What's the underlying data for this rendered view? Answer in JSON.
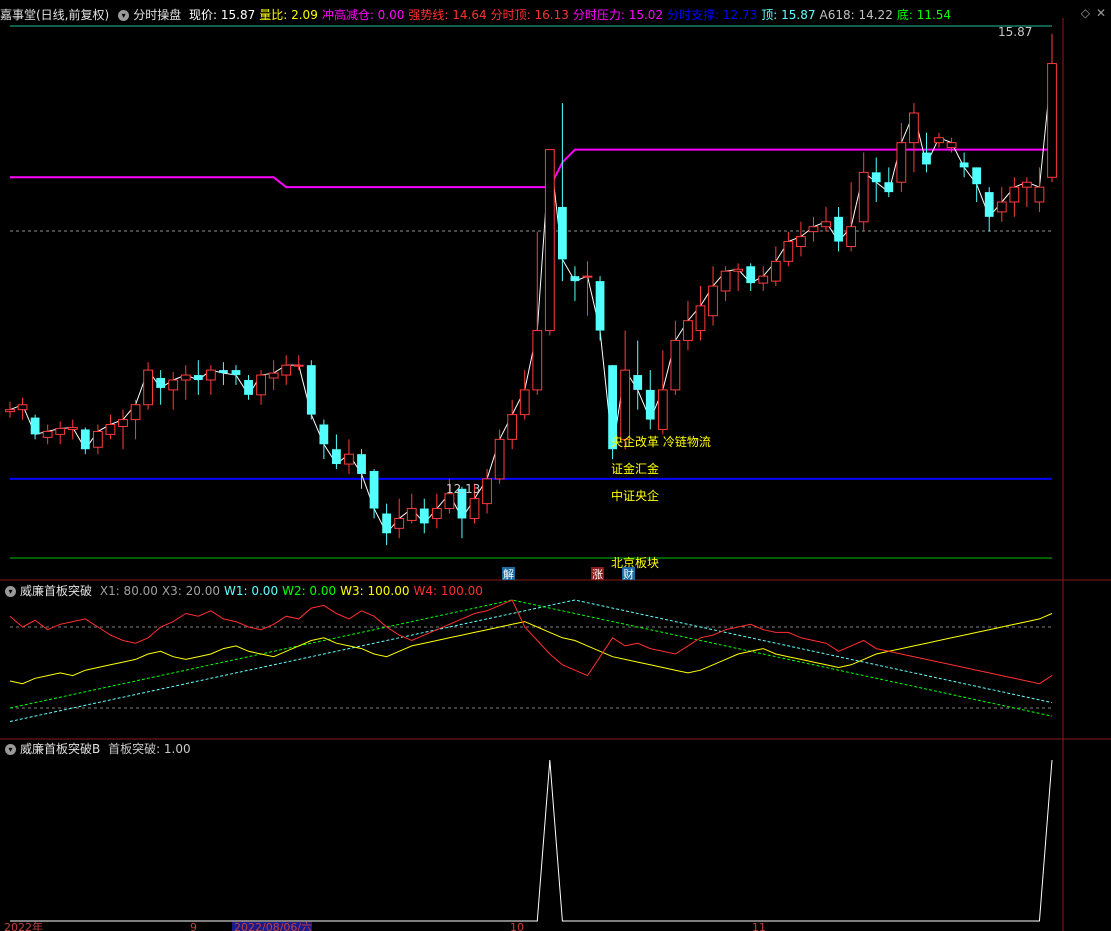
{
  "main_indicator": {
    "name": "嘉事堂(日线,前复权)",
    "formula": "分时操盘",
    "items": [
      {
        "label": "现价: ",
        "value": "15.87",
        "color": "#ffffff"
      },
      {
        "label": "量比: ",
        "value": "2.09",
        "color": "#ffff00"
      },
      {
        "label": "冲高减仓: ",
        "value": "0.00",
        "color": "#ff00ff"
      },
      {
        "label": "强势线: ",
        "value": "14.64",
        "color": "#ff3030"
      },
      {
        "label": "分时顶: ",
        "value": "16.13",
        "color": "#ff3030"
      },
      {
        "label": "分时压力: ",
        "value": "15.02",
        "color": "#ff00ff"
      },
      {
        "label": "分时支撑: ",
        "value": "12.73",
        "color": "#0000ff"
      },
      {
        "label": "顶: ",
        "value": "15.87",
        "color": "#60ffff"
      },
      {
        "label": "A618: ",
        "value": "14.22",
        "color": "#c0c0c0"
      },
      {
        "label": "底: ",
        "value": "11.54",
        "color": "#00ff00"
      }
    ]
  },
  "annotations": {
    "high_label": "15.87",
    "low_label": "12.13",
    "concepts": [
      "央企改革 冷链物流",
      "证金汇金",
      "中证央企",
      "北京板块"
    ],
    "markers": [
      "解",
      "涨",
      "财"
    ]
  },
  "pane1": {
    "name": "威廉首板突破",
    "items": [
      {
        "label": "X1: ",
        "value": "80.00",
        "color": "#a0a0a0"
      },
      {
        "label": "X3: ",
        "value": "20.00",
        "color": "#a0a0a0"
      },
      {
        "label": "W1: ",
        "value": "0.00",
        "color": "#60ffff"
      },
      {
        "label": "W2: ",
        "value": "0.00",
        "color": "#00ff00"
      },
      {
        "label": "W3: ",
        "value": "100.00",
        "color": "#ffff00"
      },
      {
        "label": "W4: ",
        "value": "100.00",
        "color": "#ff3030"
      }
    ]
  },
  "pane2": {
    "name": "威廉首板突破B",
    "items": [
      {
        "label": "首板突破: ",
        "value": "1.00",
        "color": "#c8c8c8"
      }
    ]
  },
  "date_axis": [
    "2022年",
    "9",
    "2022/08/06/六",
    "10",
    "11"
  ],
  "chart_data": {
    "type": "candlestick",
    "candles": [
      [
        13.48,
        13.5,
        13.58,
        13.42
      ],
      [
        13.5,
        13.55,
        13.62,
        13.4
      ],
      [
        13.42,
        13.25,
        13.45,
        13.2
      ],
      [
        13.22,
        13.28,
        13.35,
        13.15
      ],
      [
        13.25,
        13.31,
        13.38,
        13.15
      ],
      [
        13.3,
        13.32,
        13.4,
        13.2
      ],
      [
        13.3,
        13.1,
        13.32,
        13.05
      ],
      [
        13.12,
        13.28,
        13.35,
        13.05
      ],
      [
        13.25,
        13.35,
        13.45,
        13.2
      ],
      [
        13.33,
        13.4,
        13.5,
        13.1
      ],
      [
        13.4,
        13.55,
        13.6,
        13.2
      ],
      [
        13.55,
        13.9,
        13.98,
        13.5
      ],
      [
        13.82,
        13.72,
        13.9,
        13.55
      ],
      [
        13.7,
        13.8,
        13.88,
        13.5
      ],
      [
        13.8,
        13.85,
        13.95,
        13.6
      ],
      [
        13.85,
        13.8,
        14.0,
        13.65
      ],
      [
        13.8,
        13.9,
        13.95,
        13.65
      ],
      [
        13.9,
        13.87,
        13.98,
        13.75
      ],
      [
        13.9,
        13.85,
        13.95,
        13.75
      ],
      [
        13.8,
        13.65,
        13.85,
        13.6
      ],
      [
        13.65,
        13.85,
        13.9,
        13.55
      ],
      [
        13.82,
        13.87,
        14.0,
        13.7
      ],
      [
        13.85,
        13.95,
        14.05,
        13.75
      ],
      [
        13.95,
        13.95,
        14.05,
        13.9
      ],
      [
        13.95,
        13.45,
        14.0,
        13.4
      ],
      [
        13.35,
        13.15,
        13.4,
        13.0
      ],
      [
        13.1,
        12.95,
        13.25,
        12.9
      ],
      [
        12.95,
        13.05,
        13.2,
        12.85
      ],
      [
        13.05,
        12.85,
        13.1,
        12.7
      ],
      [
        12.88,
        12.5,
        12.9,
        12.4
      ],
      [
        12.45,
        12.25,
        12.55,
        12.13
      ],
      [
        12.3,
        12.4,
        12.6,
        12.2
      ],
      [
        12.38,
        12.5,
        12.65,
        12.35
      ],
      [
        12.5,
        12.35,
        12.6,
        12.25
      ],
      [
        12.4,
        12.5,
        12.65,
        12.3
      ],
      [
        12.5,
        12.65,
        12.8,
        12.45
      ],
      [
        12.7,
        12.4,
        12.72,
        12.2
      ],
      [
        12.4,
        12.6,
        12.75,
        12.35
      ],
      [
        12.55,
        12.8,
        12.9,
        12.45
      ],
      [
        12.8,
        13.2,
        13.3,
        12.75
      ],
      [
        13.2,
        13.45,
        13.6,
        13.1
      ],
      [
        13.45,
        13.7,
        13.9,
        13.4
      ],
      [
        13.7,
        14.3,
        15.3,
        13.65
      ],
      [
        14.3,
        16.13,
        16.13,
        14.25
      ],
      [
        15.55,
        15.02,
        16.6,
        14.8
      ],
      [
        14.85,
        14.8,
        14.95,
        14.6
      ],
      [
        14.85,
        14.85,
        15.0,
        14.45
      ],
      [
        14.8,
        14.3,
        14.85,
        14.2
      ],
      [
        13.95,
        13.1,
        13.95,
        13.0
      ],
      [
        13.2,
        13.9,
        14.3,
        13.1
      ],
      [
        13.85,
        13.7,
        14.2,
        13.5
      ],
      [
        13.7,
        13.4,
        13.9,
        13.3
      ],
      [
        13.3,
        13.7,
        14.1,
        13.25
      ],
      [
        13.7,
        14.2,
        14.4,
        13.65
      ],
      [
        14.2,
        14.4,
        14.6,
        14.1
      ],
      [
        14.3,
        14.55,
        14.75,
        14.2
      ],
      [
        14.45,
        14.75,
        14.95,
        14.35
      ],
      [
        14.7,
        14.9,
        14.95,
        14.6
      ],
      [
        14.9,
        14.92,
        14.98,
        14.7
      ],
      [
        14.95,
        14.78,
        14.98,
        14.7
      ],
      [
        14.78,
        14.85,
        14.95,
        14.7
      ],
      [
        14.8,
        15.0,
        15.15,
        14.75
      ],
      [
        15.0,
        15.2,
        15.3,
        14.95
      ],
      [
        15.15,
        15.25,
        15.4,
        15.05
      ],
      [
        15.3,
        15.35,
        15.45,
        15.2
      ],
      [
        15.35,
        15.4,
        15.55,
        15.3
      ],
      [
        15.45,
        15.2,
        15.55,
        15.1
      ],
      [
        15.15,
        15.35,
        15.8,
        15.1
      ],
      [
        15.4,
        15.9,
        16.1,
        15.3
      ],
      [
        15.9,
        15.8,
        16.05,
        15.6
      ],
      [
        15.8,
        15.7,
        15.95,
        15.65
      ],
      [
        15.8,
        16.2,
        16.4,
        15.7
      ],
      [
        16.2,
        16.5,
        16.6,
        15.9
      ],
      [
        16.1,
        15.98,
        16.3,
        15.9
      ],
      [
        16.2,
        16.25,
        16.3,
        16.15
      ],
      [
        16.15,
        16.2,
        16.25,
        16.1
      ],
      [
        16.0,
        15.95,
        16.1,
        15.85
      ],
      [
        15.95,
        15.78,
        15.95,
        15.6
      ],
      [
        15.7,
        15.45,
        15.75,
        15.3
      ],
      [
        15.5,
        15.6,
        15.75,
        15.4
      ],
      [
        15.6,
        15.75,
        15.85,
        15.45
      ],
      [
        15.75,
        15.8,
        15.85,
        15.55
      ],
      [
        15.6,
        15.75,
        15.95,
        15.5
      ],
      [
        15.85,
        17.0,
        17.3,
        15.8
      ]
    ],
    "pressure_line": [
      15.85,
      15.85,
      15.85,
      15.85,
      15.85,
      15.85,
      15.85,
      15.85,
      15.85,
      15.85,
      15.85,
      15.85,
      15.85,
      15.85,
      15.85,
      15.85,
      15.85,
      15.85,
      15.85,
      15.85,
      15.85,
      15.85,
      15.75,
      15.75,
      15.75,
      15.75,
      15.75,
      15.75,
      15.75,
      15.75,
      15.75,
      15.75,
      15.75,
      15.75,
      15.75,
      15.75,
      15.75,
      15.75,
      15.75,
      15.75,
      15.75,
      15.75,
      15.75,
      15.75,
      16.0,
      16.13,
      16.13,
      16.13,
      16.13,
      16.13,
      16.13,
      16.13,
      16.13,
      16.13,
      16.13,
      16.13,
      16.13,
      16.13,
      16.13,
      16.13,
      16.13,
      16.13,
      16.13,
      16.13,
      16.13,
      16.13,
      16.13,
      16.13,
      16.13,
      16.13,
      16.13,
      16.13,
      16.13,
      16.13,
      16.13,
      16.13,
      16.13,
      16.13,
      16.13,
      16.13,
      16.13,
      16.13,
      16.13,
      16.13
    ],
    "support_line": [
      12.8,
      12.8,
      12.8,
      12.8,
      12.8,
      12.8,
      12.8,
      12.8,
      12.8,
      12.8,
      12.8,
      12.8,
      12.8,
      12.8,
      12.8,
      12.8,
      12.8,
      12.8,
      12.8,
      12.8,
      12.8,
      12.8,
      12.8,
      12.8,
      12.8,
      12.8,
      12.8,
      12.8,
      12.8,
      12.8,
      12.8,
      12.8,
      12.8,
      12.8,
      12.8,
      12.8,
      12.8,
      12.8,
      12.8,
      12.8,
      12.8,
      12.8,
      12.8,
      12.8,
      12.8,
      12.8,
      12.8,
      12.8,
      12.8,
      12.8,
      12.8,
      12.8,
      12.8,
      12.8,
      12.8,
      12.8,
      12.8,
      12.8,
      12.8,
      12.8,
      12.8,
      12.8,
      12.8,
      12.8,
      12.8,
      12.8,
      12.8,
      12.8,
      12.8,
      12.8,
      12.8,
      12.8,
      12.8,
      12.8,
      12.8,
      12.8,
      12.8,
      12.8,
      12.8,
      12.8,
      12.8,
      12.8,
      12.8,
      12.8
    ],
    "w4_values": [
      88,
      80,
      85,
      78,
      82,
      84,
      86,
      80,
      74,
      70,
      68,
      72,
      80,
      84,
      90,
      88,
      92,
      86,
      84,
      80,
      78,
      82,
      88,
      86,
      94,
      96,
      90,
      86,
      92,
      88,
      80,
      74,
      70,
      74,
      78,
      82,
      86,
      90,
      92,
      96,
      100,
      80,
      70,
      60,
      52,
      48,
      44,
      58,
      72,
      66,
      68,
      64,
      62,
      60,
      66,
      72,
      74,
      78,
      80,
      82,
      78,
      76,
      76,
      72,
      70,
      68,
      62,
      66,
      70,
      64,
      62,
      60,
      58,
      56,
      54,
      52,
      50,
      48,
      46,
      44,
      42,
      40,
      38,
      44
    ],
    "w3_values": [
      40,
      38,
      42,
      44,
      46,
      44,
      48,
      50,
      52,
      54,
      56,
      60,
      62,
      58,
      56,
      58,
      60,
      64,
      66,
      62,
      60,
      58,
      62,
      66,
      70,
      72,
      68,
      66,
      64,
      60,
      58,
      62,
      66,
      68,
      70,
      72,
      74,
      76,
      78,
      80,
      82,
      84,
      80,
      76,
      72,
      70,
      66,
      62,
      58,
      56,
      54,
      52,
      50,
      48,
      46,
      48,
      52,
      56,
      60,
      62,
      64,
      60,
      58,
      56,
      54,
      52,
      50,
      52,
      56,
      60,
      62,
      64,
      66,
      68,
      70,
      72,
      74,
      76,
      78,
      80,
      82,
      84,
      86,
      90
    ],
    "w2_values": [
      20,
      22,
      24,
      26,
      28,
      30,
      32,
      34,
      36,
      38,
      40,
      42,
      44,
      46,
      48,
      50,
      52,
      54,
      56,
      58,
      60,
      62,
      64,
      66,
      68,
      70,
      72,
      74,
      76,
      78,
      80,
      82,
      84,
      86,
      88,
      90,
      92,
      94,
      96,
      98,
      100,
      98,
      96,
      94,
      92,
      90,
      88,
      86,
      84,
      82,
      80,
      78,
      76,
      74,
      72,
      70,
      68,
      66,
      64,
      62,
      60,
      58,
      56,
      54,
      52,
      50,
      48,
      46,
      44,
      42,
      40,
      38,
      36,
      34,
      32,
      30,
      28,
      26,
      24,
      22,
      20,
      18,
      16,
      14
    ],
    "w1_values": [
      10,
      12,
      14,
      16,
      18,
      20,
      22,
      24,
      26,
      28,
      30,
      32,
      34,
      36,
      38,
      40,
      42,
      44,
      46,
      48,
      50,
      52,
      54,
      56,
      58,
      60,
      62,
      64,
      66,
      68,
      70,
      72,
      74,
      76,
      78,
      80,
      82,
      84,
      86,
      88,
      90,
      92,
      94,
      96,
      98,
      100,
      98,
      96,
      94,
      92,
      90,
      88,
      86,
      84,
      82,
      80,
      78,
      76,
      74,
      72,
      70,
      68,
      66,
      64,
      62,
      60,
      58,
      56,
      54,
      52,
      50,
      48,
      46,
      44,
      42,
      40,
      38,
      36,
      34,
      32,
      30,
      28,
      26,
      24
    ],
    "breakout_flags": [
      0,
      0,
      0,
      0,
      0,
      0,
      0,
      0,
      0,
      0,
      0,
      0,
      0,
      0,
      0,
      0,
      0,
      0,
      0,
      0,
      0,
      0,
      0,
      0,
      0,
      0,
      0,
      0,
      0,
      0,
      0,
      0,
      0,
      0,
      0,
      0,
      0,
      0,
      0,
      0,
      0,
      0,
      0,
      1,
      0,
      0,
      0,
      0,
      0,
      0,
      0,
      0,
      0,
      0,
      0,
      0,
      0,
      0,
      0,
      0,
      0,
      0,
      0,
      0,
      0,
      0,
      0,
      0,
      0,
      0,
      0,
      0,
      0,
      0,
      0,
      0,
      0,
      0,
      0,
      0,
      0,
      0,
      0,
      1
    ],
    "price_range": [
      12.0,
      17.4
    ]
  }
}
